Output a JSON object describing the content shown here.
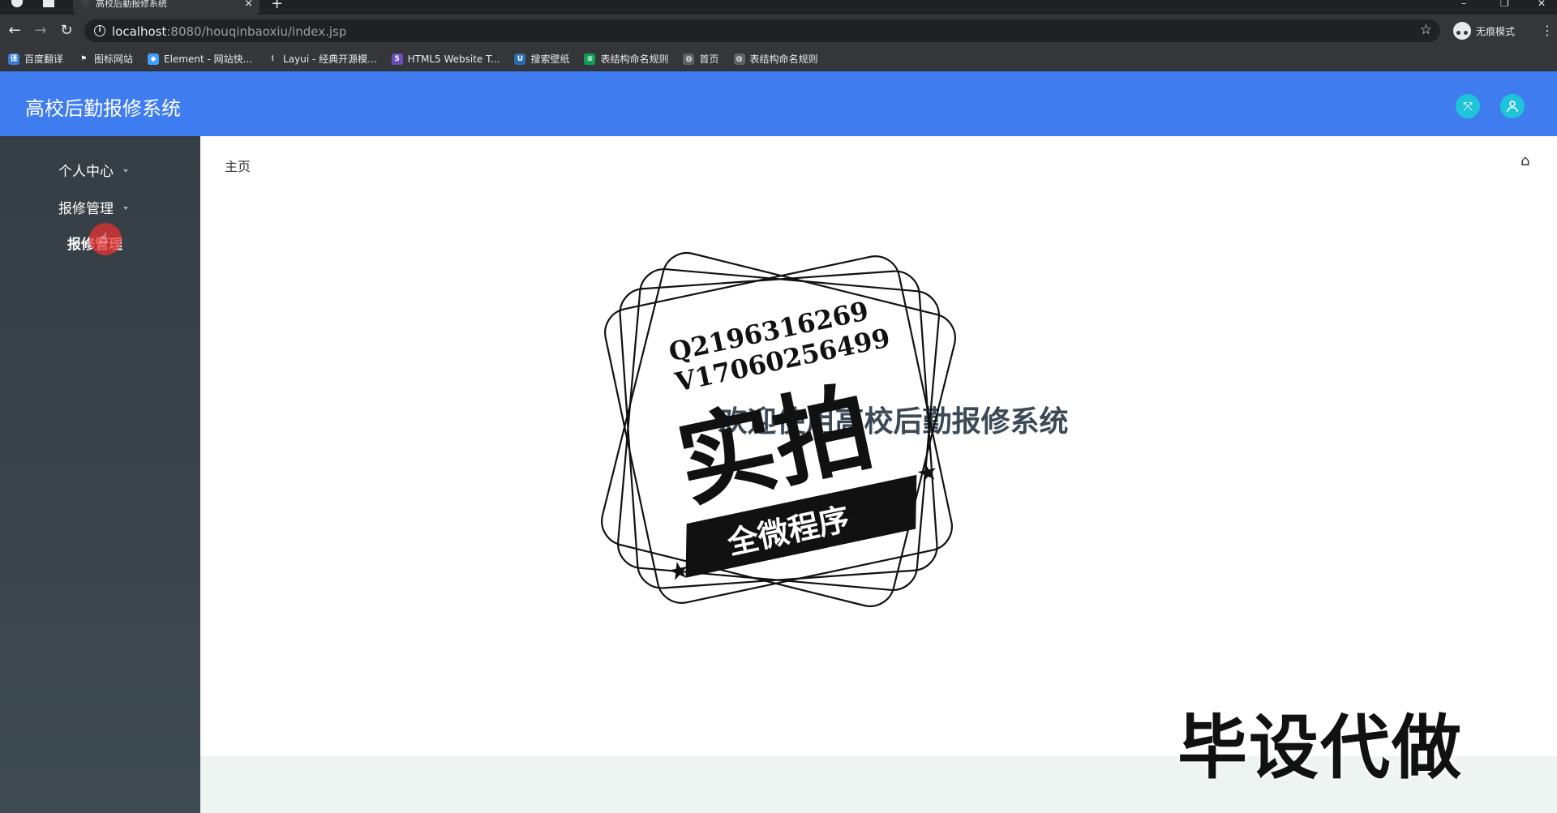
{
  "browser": {
    "tab_title": "高校后勤报修系统",
    "tab_close": "×",
    "new_tab": "+",
    "url_host": "localhost",
    "url_rest": ":8080/houqinbaoxiu/index.jsp",
    "incognito_label": "无痕模式",
    "bookmarks": [
      {
        "label": "百度翻译",
        "icon": "translate-icon",
        "color": "#3a7bd5",
        "glyph": "译"
      },
      {
        "label": "图标网站",
        "icon": "flag-icon",
        "color": "#35363a",
        "glyph": "⚑"
      },
      {
        "label": "Element - 网站快...",
        "icon": "element-icon",
        "color": "#409eff",
        "glyph": "◆"
      },
      {
        "label": "Layui - 经典开源模...",
        "icon": "layui-icon",
        "color": "#35363a",
        "glyph": "⌇"
      },
      {
        "label": "HTML5 Website T...",
        "icon": "html5-icon",
        "color": "#6b4fbb",
        "glyph": "5"
      },
      {
        "label": "搜索壁纸",
        "icon": "wallpaper-icon",
        "color": "#2b6cb0",
        "glyph": "U"
      },
      {
        "label": "表结构命名规则",
        "icon": "sheet-icon",
        "color": "#0f9d58",
        "glyph": "≡"
      },
      {
        "label": "首页",
        "icon": "globe-icon",
        "color": "#5f6368",
        "glyph": "◍"
      },
      {
        "label": "表结构命名规则",
        "icon": "globe-icon",
        "color": "#5f6368",
        "glyph": "◍"
      }
    ]
  },
  "app": {
    "title": "高校后勤报修系统",
    "accent": "#3f7cf0",
    "header_button_color": "#1ec4d8"
  },
  "sidebar": {
    "items": [
      {
        "label": "个人中心"
      },
      {
        "label": "报修管理"
      }
    ],
    "sub_items": [
      {
        "label": "报修管理"
      }
    ]
  },
  "main": {
    "breadcrumb": "主页",
    "welcome": "欢迎使用高校后勤报修系统"
  },
  "overlay": {
    "stamp_line1": "Q2196316269",
    "stamp_line2": "V1706025649",
    "stamp_line2_tail": "9",
    "stamp_big": "实拍",
    "stamp_banner": "全微程序",
    "corner_text": "毕设代做"
  }
}
